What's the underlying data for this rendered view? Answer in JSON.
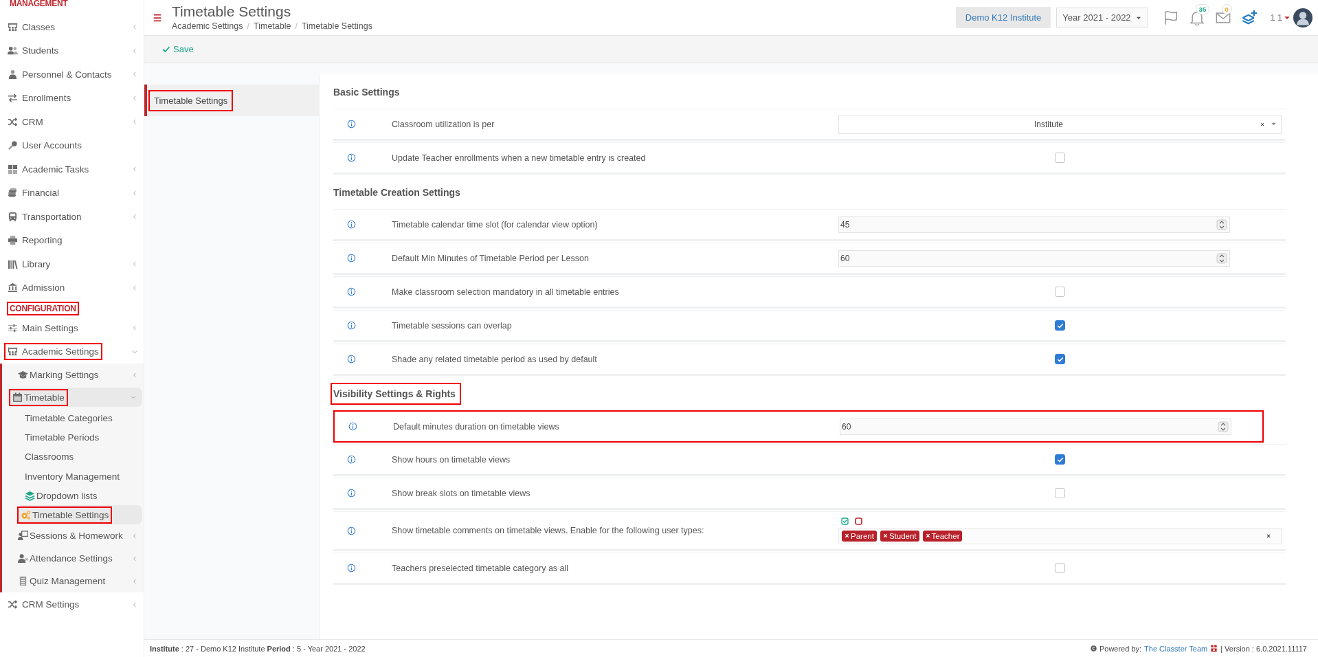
{
  "sidebar": {
    "sections": [
      {
        "title": "MANAGEMENT",
        "highlighted": false,
        "items": [
          {
            "label": "Classes",
            "has_icon": true,
            "expandable": true,
            "expanded": false,
            "selected": false,
            "highlighted": false
          },
          {
            "label": "Students",
            "has_icon": true,
            "expandable": true,
            "expanded": false,
            "selected": false,
            "highlighted": false
          },
          {
            "label": "Personnel & Contacts",
            "has_icon": true,
            "expandable": true,
            "expanded": false,
            "selected": false,
            "highlighted": false
          },
          {
            "label": "Enrollments",
            "has_icon": true,
            "expandable": true,
            "expanded": false,
            "selected": false,
            "highlighted": false
          },
          {
            "label": "CRM",
            "has_icon": true,
            "expandable": true,
            "expanded": false,
            "selected": false,
            "highlighted": false
          },
          {
            "label": "User Accounts",
            "has_icon": true,
            "expandable": false,
            "expanded": false,
            "selected": false,
            "highlighted": false
          },
          {
            "label": "Academic Tasks",
            "has_icon": true,
            "expandable": true,
            "expanded": false,
            "selected": false,
            "highlighted": false
          },
          {
            "label": "Financial",
            "has_icon": true,
            "expandable": true,
            "expanded": false,
            "selected": false,
            "highlighted": false
          },
          {
            "label": "Transportation",
            "has_icon": true,
            "expandable": true,
            "expanded": false,
            "selected": false,
            "highlighted": false
          },
          {
            "label": "Reporting",
            "has_icon": true,
            "expandable": false,
            "expanded": false,
            "selected": false,
            "highlighted": false
          },
          {
            "label": "Library",
            "has_icon": true,
            "expandable": true,
            "expanded": false,
            "selected": false,
            "highlighted": false
          },
          {
            "label": "Admission",
            "has_icon": true,
            "expandable": true,
            "expanded": false,
            "selected": false,
            "highlighted": false
          }
        ]
      },
      {
        "title": "CONFIGURATION",
        "highlighted": true,
        "items": [
          {
            "label": "Main Settings",
            "has_icon": true,
            "expandable": true,
            "expanded": false,
            "selected": false,
            "highlighted": false
          },
          {
            "label": "Academic Settings",
            "has_icon": true,
            "expandable": true,
            "expanded": true,
            "selected": false,
            "highlighted": true,
            "children": [
              {
                "label": "Marking Settings",
                "has_icon": true,
                "expandable": true,
                "expanded": false,
                "selected": false,
                "highlighted": false
              },
              {
                "label": "Timetable",
                "has_icon": true,
                "expandable": true,
                "expanded": true,
                "selected": true,
                "highlighted": true,
                "children": [
                  {
                    "label": "Timetable Categories",
                    "has_icon": false,
                    "expandable": false,
                    "expanded": false,
                    "selected": false,
                    "highlighted": false
                  },
                  {
                    "label": "Timetable Periods",
                    "has_icon": false,
                    "expandable": false,
                    "expanded": false,
                    "selected": false,
                    "highlighted": false
                  },
                  {
                    "label": "Classrooms",
                    "has_icon": false,
                    "expandable": false,
                    "expanded": false,
                    "selected": false,
                    "highlighted": false
                  },
                  {
                    "label": "Inventory Management",
                    "has_icon": false,
                    "expandable": false,
                    "expanded": false,
                    "selected": false,
                    "highlighted": false
                  },
                  {
                    "label": "Dropdown lists",
                    "has_icon": true,
                    "expandable": false,
                    "expanded": false,
                    "selected": false,
                    "highlighted": false
                  },
                  {
                    "label": "Timetable Settings",
                    "has_icon": true,
                    "expandable": false,
                    "expanded": false,
                    "selected": true,
                    "highlighted": true
                  }
                ]
              },
              {
                "label": "Sessions & Homework",
                "has_icon": true,
                "expandable": true,
                "expanded": false,
                "selected": false,
                "highlighted": false
              },
              {
                "label": "Attendance Settings",
                "has_icon": true,
                "expandable": true,
                "expanded": false,
                "selected": false,
                "highlighted": false
              },
              {
                "label": "Quiz Management",
                "has_icon": true,
                "expandable": true,
                "expanded": false,
                "selected": false,
                "highlighted": false
              }
            ]
          },
          {
            "label": "CRM Settings",
            "has_icon": true,
            "expandable": true,
            "expanded": false,
            "selected": false,
            "highlighted": false
          }
        ]
      }
    ]
  },
  "header": {
    "title": "Timetable Settings",
    "breadcrumbs": [
      "Academic Settings",
      "Timetable",
      "Timetable Settings"
    ],
    "breadcrumb_separators": [
      "/",
      "/"
    ],
    "institute": "Demo K12 Institute",
    "year": "Year 2021 - 2022",
    "notifications": "35",
    "messages": "0",
    "user": "1 1"
  },
  "toolbar": {
    "save": "Save"
  },
  "tabs": [
    {
      "label": "Timetable Settings",
      "selected": true,
      "highlighted": true
    }
  ],
  "sections": [
    {
      "title": "Basic Settings",
      "highlighted": false,
      "rows": [
        {
          "kind": "select",
          "label": "Classroom utilization is per",
          "value": "Institute",
          "highlighted": false
        },
        {
          "kind": "checkbox",
          "label": "Update Teacher enrollments when a new timetable entry is created",
          "checked": false,
          "highlighted": false
        }
      ]
    },
    {
      "title": "Timetable Creation Settings",
      "highlighted": false,
      "rows": [
        {
          "kind": "number",
          "label": "Timetable calendar time slot (for calendar view option)",
          "value": "45",
          "highlighted": false
        },
        {
          "kind": "number",
          "label": "Default Min Minutes of Timetable Period per Lesson",
          "value": "60",
          "highlighted": false
        },
        {
          "kind": "checkbox",
          "label": "Make classroom selection mandatory in all timetable entries",
          "checked": false,
          "highlighted": false
        },
        {
          "kind": "checkbox",
          "label": "Timetable sessions can overlap",
          "checked": true,
          "highlighted": false
        },
        {
          "kind": "checkbox",
          "label": "Shade any related timetable period as used by default",
          "checked": true,
          "highlighted": false
        }
      ]
    },
    {
      "title": "Visibility Settings & Rights",
      "highlighted": true,
      "rows": [
        {
          "kind": "number",
          "label": "Default minutes duration on timetable views",
          "value": "60",
          "highlighted": true
        },
        {
          "kind": "checkbox",
          "label": "Show hours on timetable views",
          "checked": true,
          "highlighted": false
        },
        {
          "kind": "checkbox",
          "label": "Show break slots on timetable views",
          "checked": false,
          "highlighted": false
        },
        {
          "kind": "tags",
          "label": "Show timetable comments on timetable views. Enable for the following user types:",
          "tags": [
            "Parent",
            "Student",
            "Teacher"
          ],
          "highlighted": false
        },
        {
          "kind": "checkbox",
          "label": "Teachers preselected timetable category as all",
          "checked": false,
          "highlighted": false
        }
      ]
    }
  ],
  "footer": {
    "info": "**Institute** : 27 - Demo K12 Institute **Period** : 5 - Year 2021 - 2022",
    "powered": "Powered by:",
    "link": "The Classter Team",
    "version": "| Version : 6.0.2021.11117"
  }
}
